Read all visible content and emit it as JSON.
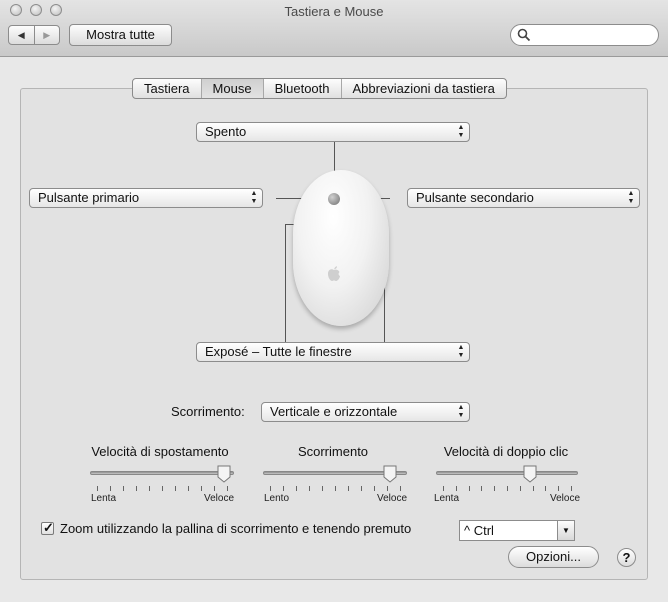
{
  "window": {
    "title": "Tastiera e Mouse"
  },
  "toolbar": {
    "back_icon": "◀",
    "forward_icon": "▶",
    "show_all": "Mostra tutte",
    "search_value": ""
  },
  "tabs": [
    {
      "label": "Tastiera",
      "selected": false
    },
    {
      "label": "Mouse",
      "selected": true
    },
    {
      "label": "Bluetooth",
      "selected": false
    },
    {
      "label": "Abbreviazioni da tastiera",
      "selected": false
    }
  ],
  "mouse_buttons": {
    "top": "Spento",
    "left": "Pulsante primario",
    "right": "Pulsante secondario",
    "bottom": "Exposé – Tutte le finestre"
  },
  "scrolling": {
    "label": "Scorrimento:",
    "value": "Verticale e orizzontale"
  },
  "sliders": [
    {
      "title": "Velocità di spostamento",
      "min_label": "Lenta",
      "max_label": "Veloce",
      "value": 0.98
    },
    {
      "title": "Scorrimento",
      "min_label": "Lento",
      "max_label": "Veloce",
      "value": 0.92
    },
    {
      "title": "Velocità di doppio clic",
      "min_label": "Lenta",
      "max_label": "Veloce",
      "value": 0.68
    }
  ],
  "zoom": {
    "label": "Zoom utilizzando la pallina di scorrimento e tenendo premuto",
    "checked": true,
    "modifier": "^ Ctrl"
  },
  "buttons": {
    "options": "Opzioni...",
    "help": "?"
  },
  "icons": {
    "close": "close-icon",
    "minimize": "minimize-icon",
    "zoom": "zoom-icon",
    "search": "search-icon",
    "apple": "apple-logo-icon",
    "popup": "updown-arrows-icon",
    "combo": "chevron-down-icon",
    "checkbox": "checkmark-icon",
    "help": "help-icon"
  },
  "colors": {
    "panel": "#e2e2e2",
    "window": "#e8e8e8"
  }
}
